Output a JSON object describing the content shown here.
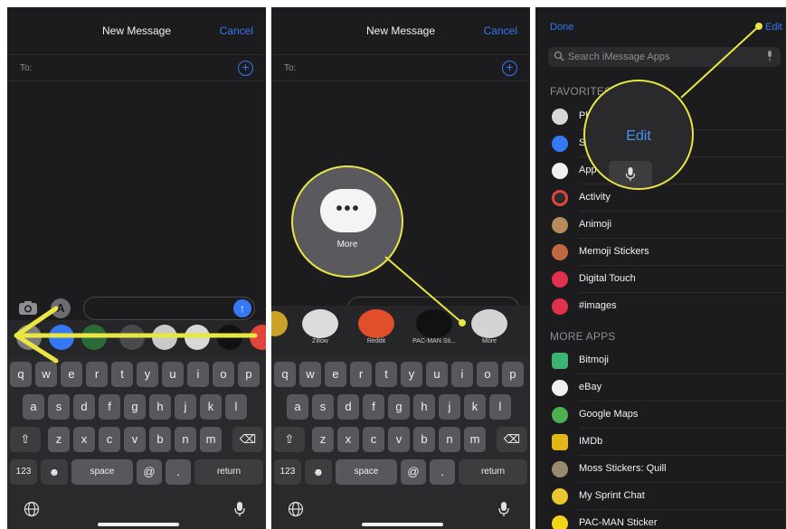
{
  "panel1": {
    "title": "New Message",
    "cancel": "Cancel",
    "to_label": "To:",
    "keys_row1": [
      "q",
      "w",
      "e",
      "r",
      "t",
      "y",
      "u",
      "i",
      "o",
      "p"
    ],
    "keys_row2": [
      "a",
      "s",
      "d",
      "f",
      "g",
      "h",
      "j",
      "k",
      "l"
    ],
    "keys_row3": [
      "z",
      "x",
      "c",
      "v",
      "b",
      "n",
      "m"
    ],
    "key_123": "123",
    "key_space": "space",
    "key_at": "@",
    "key_dot": ".",
    "key_return": "return"
  },
  "panel2": {
    "title": "New Message",
    "cancel": "Cancel",
    "to_label": "To:",
    "apps": [
      "Zillow",
      "Reddit",
      "PAC-MAN Sti...",
      "More"
    ],
    "callout_label": "More"
  },
  "panel3": {
    "done": "Done",
    "edit": "Edit",
    "search_placeholder": "Search iMessage Apps",
    "favorites_header": "FAVORITES",
    "favorites": [
      "Ph",
      "S",
      "App",
      "Activity",
      "Animoji",
      "Memoji Stickers",
      "Digital Touch",
      "#images"
    ],
    "more_apps_header": "MORE APPS",
    "more_apps": [
      "Bitmoji",
      "eBay",
      "Google Maps",
      "IMDb",
      "Moss Stickers: Quill",
      "My Sprint Chat",
      "PAC-MAN Sticker"
    ],
    "callout_label": "Edit"
  },
  "colors": {
    "accent": "#3478f6",
    "highlight": "#e9e642",
    "background": "#1c1c1e"
  },
  "icons": [
    "plus-circle-icon",
    "camera-icon",
    "app-store-icon",
    "send-arrow-icon",
    "globe-icon",
    "microphone-icon",
    "shift-icon",
    "delete-icon",
    "emoji-icon",
    "search-icon"
  ]
}
